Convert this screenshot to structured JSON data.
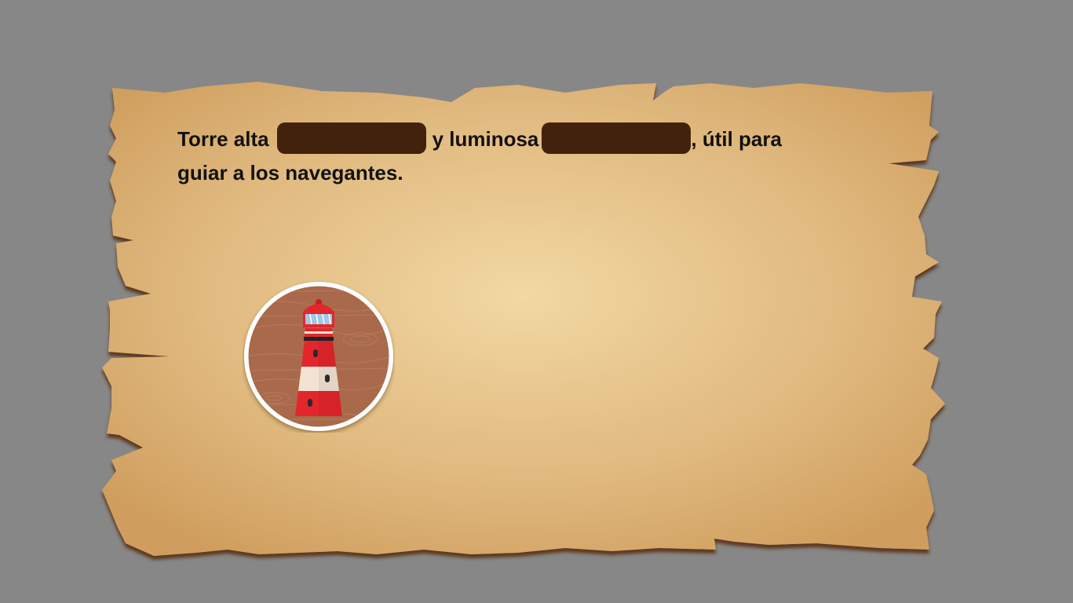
{
  "sentence": {
    "part1": "Torre alta",
    "part2": "y luminosa",
    "part3": ", útil para",
    "line2": "guiar a los navegantes."
  },
  "answer_slots": [
    {
      "state": "empty",
      "color": "#43220d"
    },
    {
      "state": "empty",
      "color": "#43220d"
    }
  ],
  "image_card": {
    "icon": "lighthouse-icon",
    "colors": {
      "background": "#a86a4a",
      "border": "#ffffff",
      "tower_red": "#e3262c",
      "tower_white": "#f3e3d3"
    }
  },
  "colors": {
    "page_background": "#878787",
    "parchment_light": "#f2d8a2",
    "parchment_dark": "#cf9e5e",
    "parchment_shadow": "#6b3f1a"
  }
}
